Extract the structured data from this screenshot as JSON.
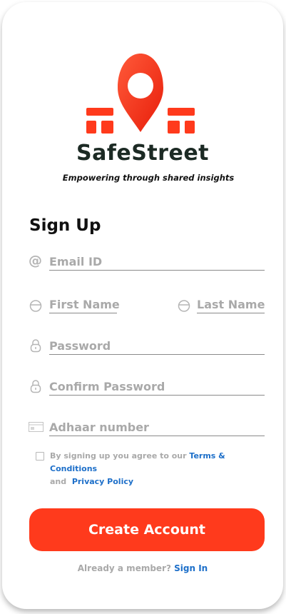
{
  "brand": {
    "name": "SafeStreet",
    "tagline": "Empowering through shared insights",
    "accent": "#ff3a1c"
  },
  "form": {
    "title": "Sign Up",
    "email_label": "Email ID",
    "first_name_label": "First Name",
    "last_name_label": "Last Name",
    "password_label": "Password",
    "confirm_password_label": "Confirm Password",
    "adhaar_label": "Adhaar number",
    "consent_prefix": "By signing up you agree to our ",
    "terms_link": "Terms & Conditions",
    "consent_and": "and",
    "privacy_link": "Privacy Policy",
    "consent_checked": false,
    "submit_label": "Create Account"
  },
  "footer": {
    "member_text": "Already a member?",
    "signin_link": "Sign In"
  },
  "icons": {
    "email": "at-icon",
    "first_name": "user-icon",
    "last_name": "user-icon",
    "password": "lock-icon",
    "confirm_password": "lock-icon",
    "adhaar": "id-card-icon"
  }
}
